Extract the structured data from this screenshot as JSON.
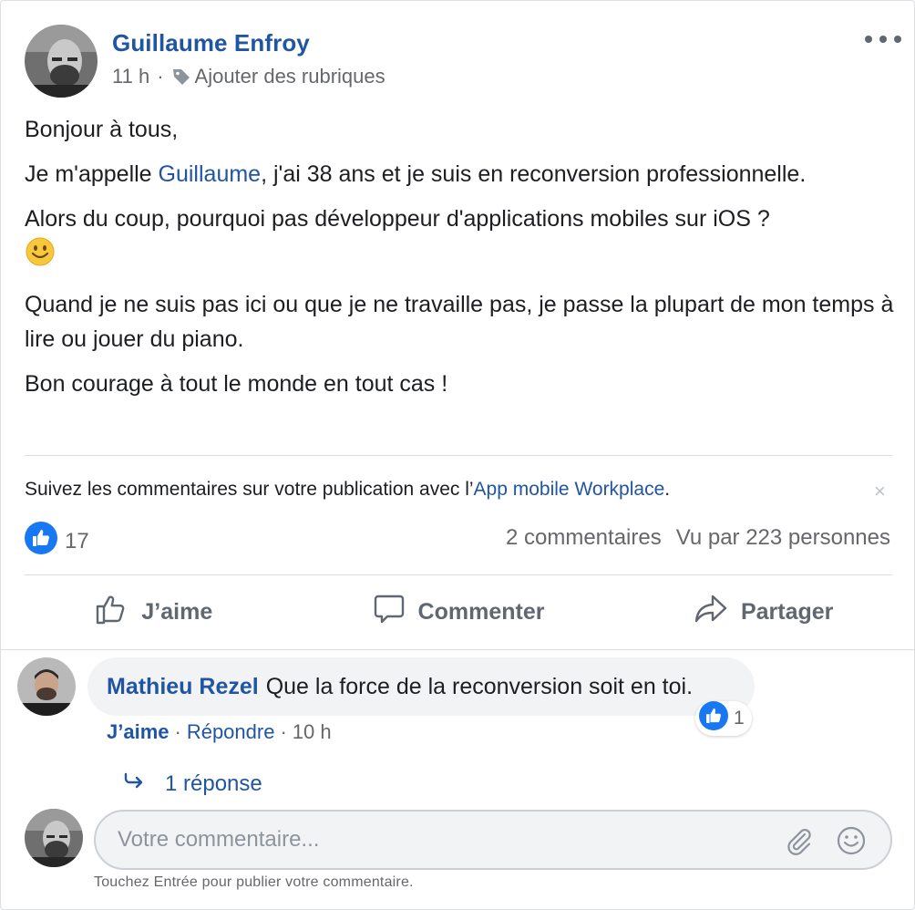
{
  "post": {
    "author": "Guillaume Enfroy",
    "time": "11 h",
    "meta_sep": "·",
    "add_topics": "Ajouter des rubriques",
    "paragraphs": {
      "p1": "Bonjour à tous,",
      "p2_before": "Je m'appelle ",
      "p2_mention": "Guillaume",
      "p2_after": ", j'ai 38 ans et je suis en reconversion professionnelle.",
      "p3": "Alors du coup, pourquoi pas développeur d'applications mobiles sur iOS ?",
      "p4": "Quand je ne suis pas ici ou que je ne travaille pas, je passe la plupart de mon temps à lire ou jouer du piano.",
      "p5": "Bon courage à tout le monde en tout cas !"
    }
  },
  "notice": {
    "text": "Suivez les commentaires sur votre publication avec l’",
    "link": "App mobile Workplace",
    "end": ".",
    "close": "×"
  },
  "stats": {
    "likes": "17",
    "comments": "2 commentaires",
    "seen": "Vu par 223 personnes"
  },
  "actions": {
    "like": "J’aime",
    "comment": "Commenter",
    "share": "Partager"
  },
  "comment": {
    "author": "Mathieu Rezel",
    "text": "Que la force de la reconversion soit en toi.",
    "reaction_count": "1",
    "like": "J’aime",
    "sep": "·",
    "reply": "Répondre",
    "time": "10 h",
    "replies_link": "1 réponse"
  },
  "composer": {
    "placeholder": "Votre commentaire...",
    "hint": "Touchez Entrée pour publier votre commentaire."
  },
  "colors": {
    "link": "#2055a4",
    "like_blue": "#1877f2",
    "muted": "#65676b"
  },
  "icons": [
    "more-dots-icon",
    "tag-icon",
    "smile-emoji-icon",
    "like-thumb-icon",
    "comment-bubble-icon",
    "share-arrow-icon",
    "reply-arrow-icon",
    "paperclip-icon",
    "emoji-icon",
    "close-icon"
  ]
}
